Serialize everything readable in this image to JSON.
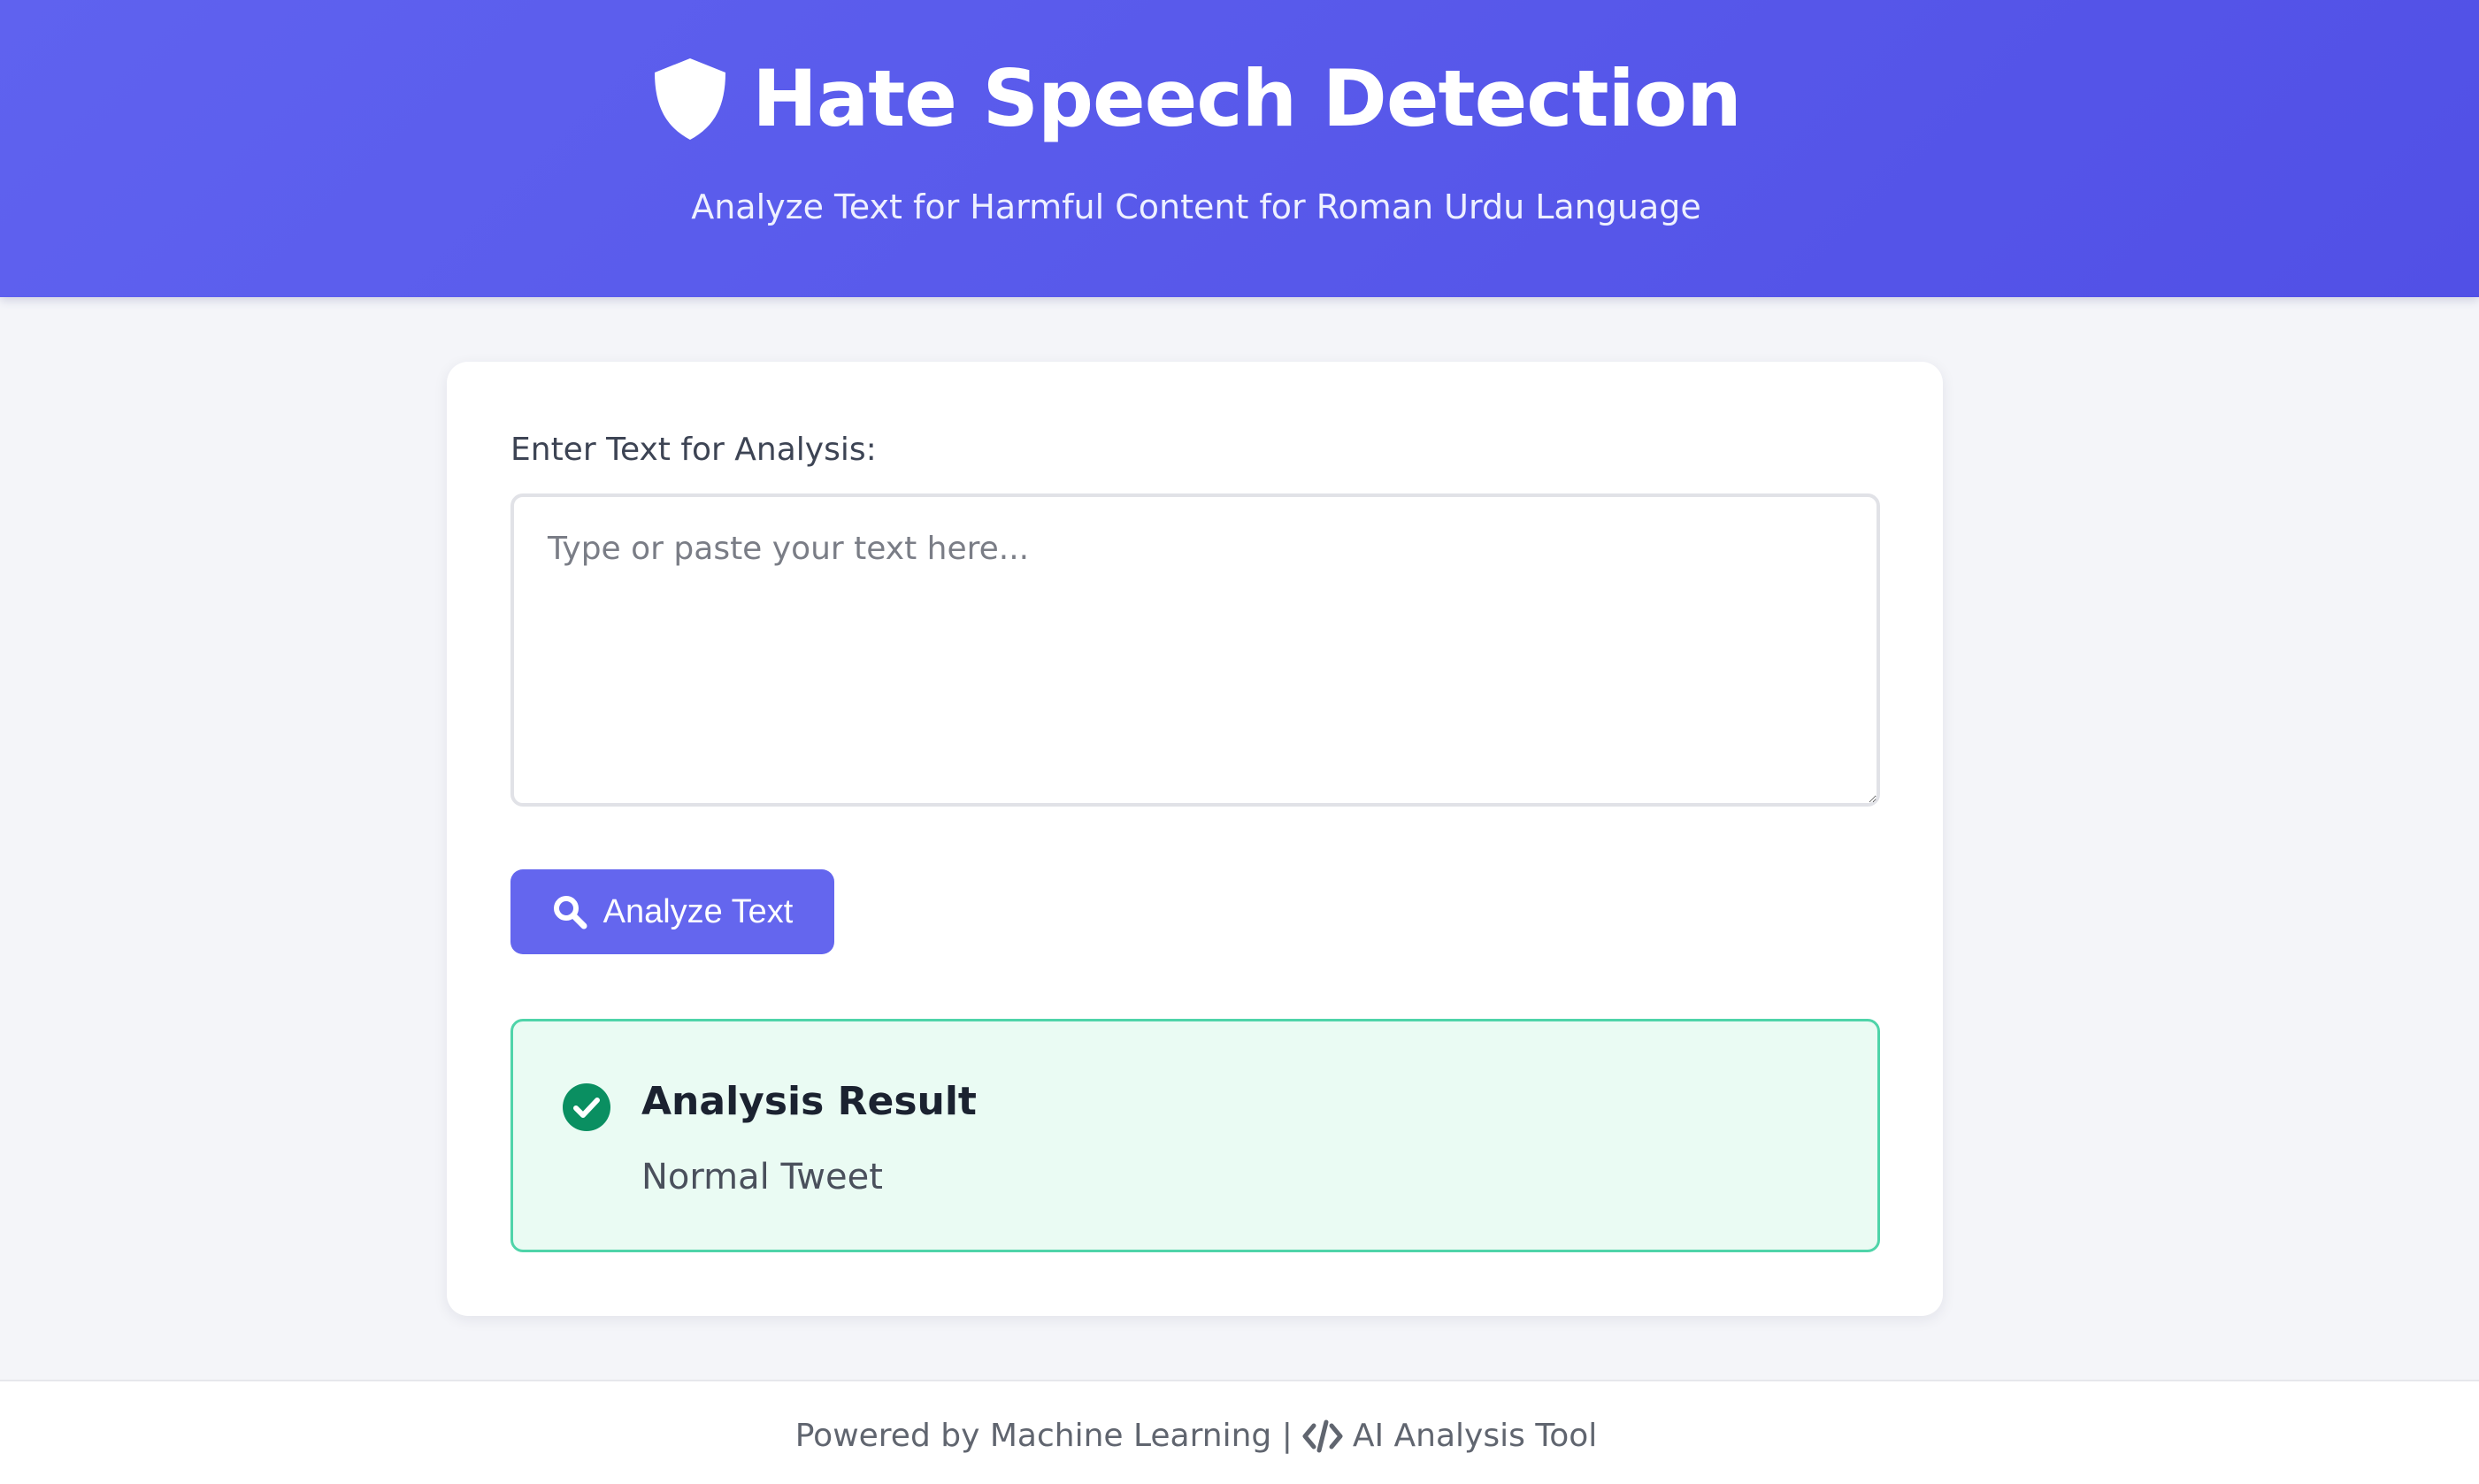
{
  "header": {
    "title": "Hate Speech Detection",
    "subtitle": "Analyze Text for Harmful Content for Roman Urdu Language",
    "icon": "shield-icon"
  },
  "form": {
    "label": "Enter Text for Analysis:",
    "input_value": "",
    "placeholder": "Type or paste your text here...",
    "button_label": "Analyze Text",
    "button_icon": "search-icon"
  },
  "result": {
    "title": "Analysis Result",
    "value": "Normal Tweet",
    "icon": "check-circle-icon"
  },
  "footer": {
    "left_text": "Powered by Machine Learning |",
    "icon": "code-icon",
    "right_text": "AI Analysis Tool"
  },
  "colors": {
    "header_gradient_start": "#5f62ef",
    "header_gradient_end": "#5150e6",
    "button": "#6466ee",
    "result_border": "#4fd4a9",
    "result_background": "#eafbf3",
    "check_icon": "#0a8f61",
    "page_background": "#f4f5f9"
  }
}
